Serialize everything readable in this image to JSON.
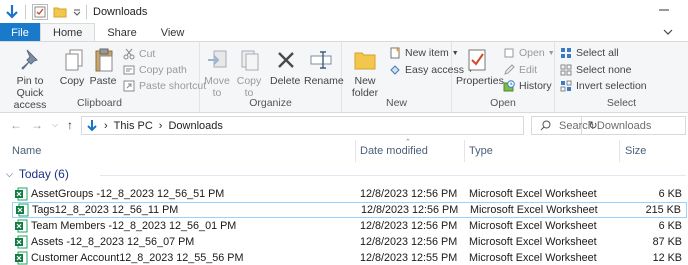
{
  "window": {
    "title": "Downloads"
  },
  "ribbon_tabs": [
    "File",
    "Home",
    "Share",
    "View"
  ],
  "ribbon": {
    "clipboard": {
      "pin_label": "Pin to Quick access",
      "copy": "Copy",
      "paste": "Paste",
      "cut": "Cut",
      "copy_path": "Copy path",
      "paste_shortcut": "Paste shortcut",
      "group_label": "Clipboard"
    },
    "organize": {
      "move_to": "Move to",
      "copy_to": "Copy to",
      "delete": "Delete",
      "rename": "Rename",
      "group_label": "Organize"
    },
    "new": {
      "new_folder": "New folder",
      "new_item": "New item",
      "easy_access": "Easy access",
      "group_label": "New"
    },
    "open": {
      "properties": "Properties",
      "open": "Open",
      "edit": "Edit",
      "history": "History",
      "group_label": "Open"
    },
    "select": {
      "select_all": "Select all",
      "select_none": "Select none",
      "invert_selection": "Invert selection",
      "group_label": "Select"
    }
  },
  "address": {
    "crumbs": [
      "This PC",
      "Downloads"
    ],
    "search_placeholder": "Search Downloads"
  },
  "columns": {
    "name": "Name",
    "date": "Date modified",
    "type": "Type",
    "size": "Size"
  },
  "group": {
    "label": "Today (6)"
  },
  "files": [
    {
      "name": "AssetGroups -12_8_2023 12_56_51 PM",
      "date": "12/8/2023 12:56 PM",
      "type": "Microsoft Excel Worksheet",
      "size": "6 KB"
    },
    {
      "name": "Tags12_8_2023 12_56_11 PM",
      "date": "12/8/2023 12:56 PM",
      "type": "Microsoft Excel Worksheet",
      "size": "215 KB"
    },
    {
      "name": "Team Members -12_8_2023 12_56_01 PM",
      "date": "12/8/2023 12:56 PM",
      "type": "Microsoft Excel Worksheet",
      "size": "6 KB"
    },
    {
      "name": "Assets -12_8_2023 12_56_07 PM",
      "date": "12/8/2023 12:56 PM",
      "type": "Microsoft Excel Worksheet",
      "size": "87 KB"
    },
    {
      "name": "Customer Account12_8_2023 12_55_56 PM",
      "date": "12/8/2023 12:55 PM",
      "type": "Microsoft Excel Worksheet",
      "size": "12 KB"
    }
  ]
}
